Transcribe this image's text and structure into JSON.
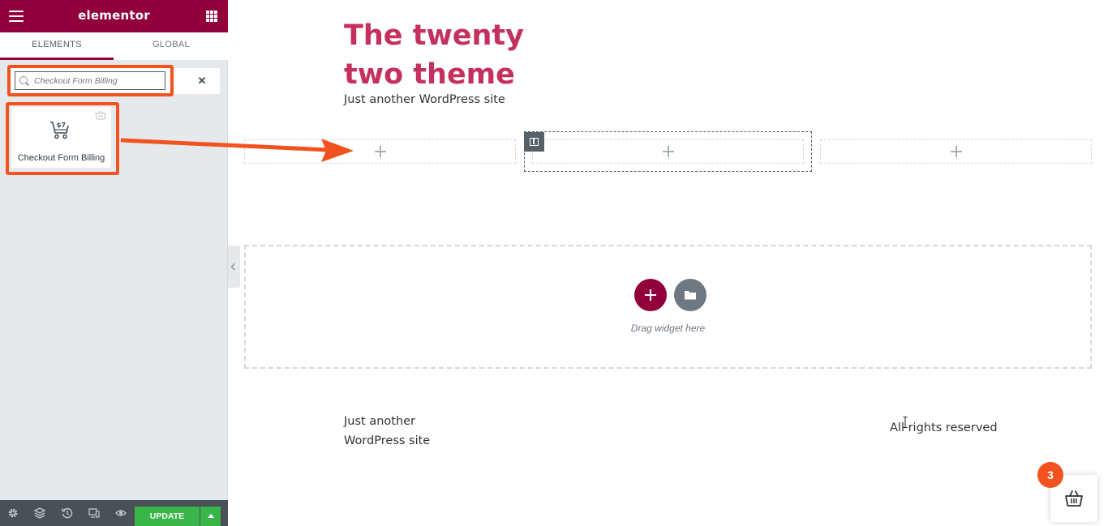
{
  "sidebar": {
    "logo": "elementor",
    "tabs": [
      {
        "label": "ELEMENTS",
        "active": true
      },
      {
        "label": "GLOBAL",
        "active": false
      }
    ],
    "search": {
      "value": "",
      "placeholder": "Checkout Form Billing"
    },
    "widget": {
      "label": "Checkout Form Billing",
      "icon": "cart-dollar-icon",
      "pro_icon": "pro-basket-icon"
    },
    "footer": {
      "icons": [
        "gear-icon",
        "layers-icon",
        "history-icon",
        "responsive-icon",
        "eye-icon"
      ],
      "update_label": "UPDATE"
    }
  },
  "canvas": {
    "site_title": "The twenty two theme",
    "site_tagline": "Just another WordPress site",
    "drag_hint": "Drag widget here",
    "footer_tagline": "Just another WordPress site",
    "footer_rights": "All rights reserved",
    "cart_count": "3"
  },
  "colors": {
    "brand": "#92003b",
    "highlight": "#f1521f",
    "title": "#c5315f",
    "update_button": "#39b54a"
  }
}
